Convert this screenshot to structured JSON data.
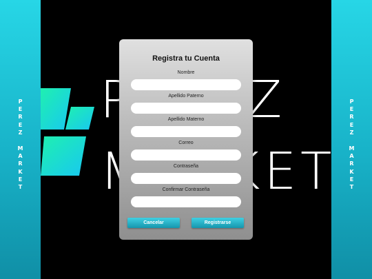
{
  "brand": {
    "side_letters": [
      "P",
      "E",
      "R",
      "E",
      "Z",
      "",
      "M",
      "A",
      "R",
      "K",
      "E",
      "T"
    ]
  },
  "background": {
    "line1": "PEREZ",
    "line2": "MARKET"
  },
  "form": {
    "title": "Registra tu Cuenta",
    "fields": [
      {
        "label": "Nombre",
        "value": ""
      },
      {
        "label": "Apellido Paterno",
        "value": ""
      },
      {
        "label": "Apellido Materno",
        "value": ""
      },
      {
        "label": "Correo",
        "value": ""
      },
      {
        "label": "Contraseña",
        "value": ""
      },
      {
        "label": "Confirmar Contraseña",
        "value": ""
      }
    ],
    "cancel_label": "Cancelar",
    "submit_label": "Registrarse"
  },
  "colors": {
    "accent": "#1fc3d8",
    "background": "#000000"
  }
}
